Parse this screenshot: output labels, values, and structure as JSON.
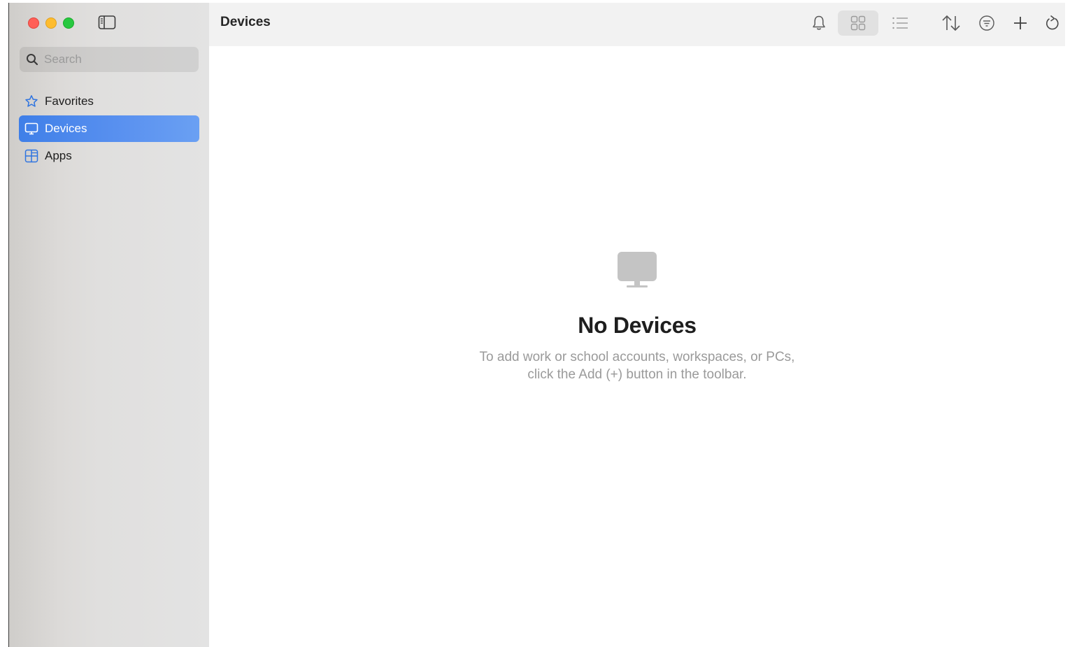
{
  "window": {
    "controls": [
      "close",
      "minimize",
      "maximize"
    ]
  },
  "sidebar": {
    "toggle_icon": "sidebar-left-icon",
    "search": {
      "placeholder": "Search",
      "value": "",
      "icon": "search-icon"
    },
    "items": [
      {
        "label": "Favorites",
        "icon": "star-icon",
        "active": false
      },
      {
        "label": "Devices",
        "icon": "monitor-icon",
        "active": true
      },
      {
        "label": "Apps",
        "icon": "apps-grid-icon",
        "active": false
      }
    ],
    "accent_color": "#4a88ec"
  },
  "toolbar": {
    "title": "Devices",
    "buttons": [
      {
        "name": "notifications",
        "icon": "bell-icon"
      },
      {
        "name": "grid-view",
        "icon": "grid-icon",
        "selected": true
      },
      {
        "name": "list-view",
        "icon": "list-icon"
      },
      {
        "name": "sort",
        "icon": "sort-arrows-icon"
      },
      {
        "name": "filter",
        "icon": "filter-icon"
      },
      {
        "name": "add",
        "icon": "plus-icon"
      },
      {
        "name": "refresh",
        "icon": "refresh-icon"
      }
    ]
  },
  "empty_state": {
    "icon": "monitor-icon",
    "title": "No Devices",
    "line1": "To add work or school accounts, workspaces, or PCs,",
    "line2": "click the Add (+) button in the toolbar."
  }
}
